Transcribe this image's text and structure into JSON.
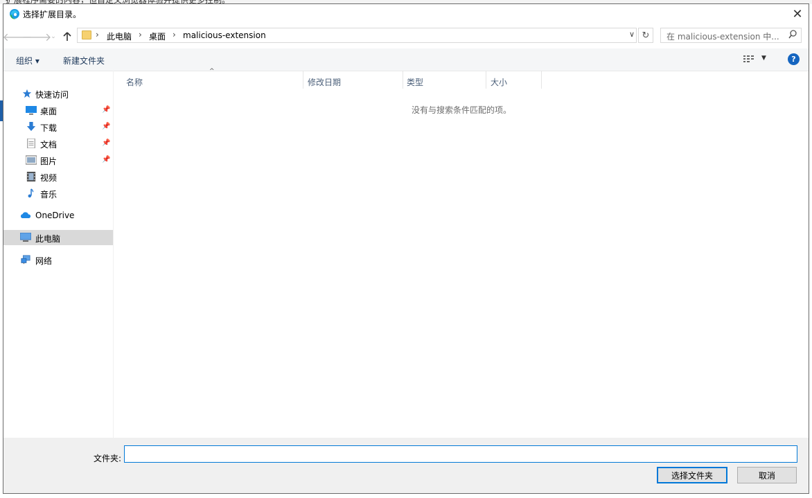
{
  "dialog": {
    "title": "选择扩展目录。",
    "close_label": "✕"
  },
  "address": {
    "breadcrumbs": [
      "此电脑",
      "桌面",
      "malicious-extension"
    ],
    "search_placeholder": "在 malicious-extension 中..."
  },
  "command_bar": {
    "organize_label": "组织 ▾",
    "new_folder_label": "新建文件夹",
    "help_label": "?"
  },
  "nav_pane": {
    "quick_access": "快速访问",
    "items": [
      {
        "label": "桌面",
        "icon": "desktop-icon",
        "pinned": true
      },
      {
        "label": "下载",
        "icon": "download-icon",
        "pinned": true
      },
      {
        "label": "文档",
        "icon": "document-icon",
        "pinned": true
      },
      {
        "label": "图片",
        "icon": "pictures-icon",
        "pinned": true
      },
      {
        "label": "视频",
        "icon": "video-icon",
        "pinned": false
      },
      {
        "label": "音乐",
        "icon": "music-icon",
        "pinned": false
      }
    ],
    "onedrive": "OneDrive",
    "this_pc": "此电脑",
    "network": "网络"
  },
  "columns": [
    "名称",
    "修改日期",
    "类型",
    "大小"
  ],
  "empty_message": "没有与搜索条件匹配的项。",
  "footer": {
    "folder_label": "文件夹:",
    "folder_value": "",
    "select_button": "选择文件夹",
    "cancel_button": "取消"
  },
  "colors": {
    "accent": "#0078d7",
    "help": "#1565c0",
    "selected_nav": "#d9d9d9"
  }
}
